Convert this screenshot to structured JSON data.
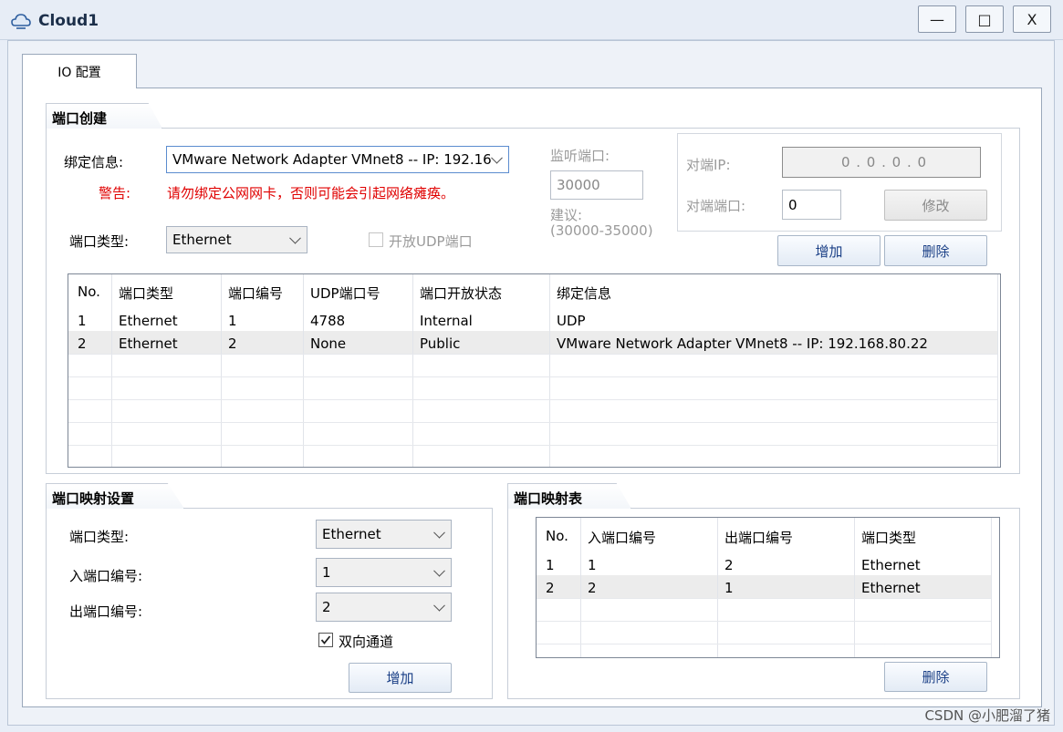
{
  "window": {
    "title": "Cloud1",
    "minimize": "—",
    "maximize": "□",
    "close": "X"
  },
  "tabs": [
    {
      "label": "IO 配置"
    }
  ],
  "port_create": {
    "title": "端口创建",
    "binding_label": "绑定信息:",
    "binding_value": "VMware Network Adapter VMnet8 -- IP: 192.16",
    "warning_label": "警告:",
    "warning_text": "请勿绑定公网网卡，否则可能会引起网络瘫痪。",
    "port_type_label": "端口类型:",
    "port_type_value": "Ethernet",
    "udp_open_label": "开放UDP端口",
    "listen_label": "监听端口:",
    "listen_value": "30000",
    "suggest_label": "建议:",
    "suggest_range": "(30000-35000)",
    "peer_ip_label": "对端IP:",
    "peer_ip_value": "0  .  0  .  0  .  0",
    "peer_port_label": "对端端口:",
    "peer_port_value": "0",
    "modify_button": "修改",
    "add_button": "增加",
    "delete_button": "删除"
  },
  "port_table": {
    "headers": [
      "No.",
      "端口类型",
      "端口编号",
      "UDP端口号",
      "端口开放状态",
      "绑定信息"
    ],
    "rows": [
      [
        "1",
        "Ethernet",
        "1",
        "4788",
        "Internal",
        "UDP"
      ],
      [
        "2",
        "Ethernet",
        "2",
        "None",
        "Public",
        "VMware Network Adapter VMnet8 -- IP: 192.168.80.22"
      ]
    ]
  },
  "mapping_settings": {
    "title": "端口映射设置",
    "port_type_label": "端口类型:",
    "port_type_value": "Ethernet",
    "in_port_label": "入端口编号:",
    "in_port_value": "1",
    "out_port_label": "出端口编号:",
    "out_port_value": "2",
    "bidirectional_label": "双向通道",
    "add_button": "增加"
  },
  "mapping_table": {
    "title": "端口映射表",
    "headers": [
      "No.",
      "入端口编号",
      "出端口编号",
      "端口类型"
    ],
    "rows": [
      [
        "1",
        "1",
        "2",
        "Ethernet"
      ],
      [
        "2",
        "2",
        "1",
        "Ethernet"
      ]
    ],
    "delete_button": "删除"
  },
  "watermark": "CSDN @小肥溜了猪"
}
